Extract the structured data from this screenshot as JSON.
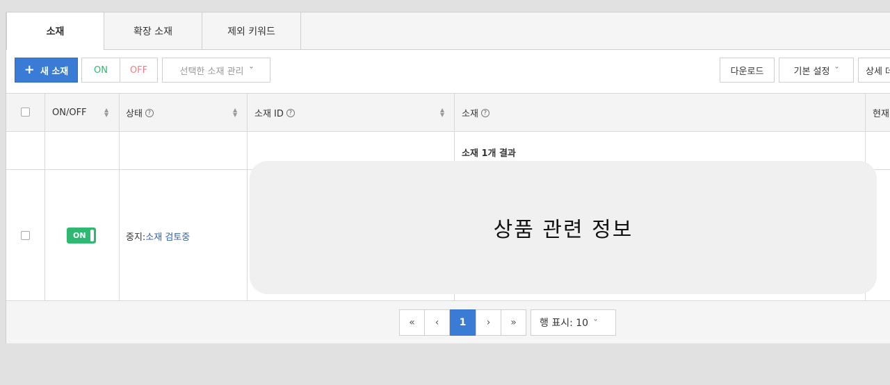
{
  "tabs": [
    {
      "label": "소재"
    },
    {
      "label": "확장 소재"
    },
    {
      "label": "제외 키워드"
    }
  ],
  "toolbar": {
    "new_label": "새 소재",
    "on_label": "ON",
    "off_label": "OFF",
    "manage_label": "선택한 소재 관리",
    "download_label": "다운로드",
    "default_settings_label": "기본 설정",
    "detail_label": "상세 데"
  },
  "table": {
    "headers": {
      "onoff": "ON/OFF",
      "status": "상태",
      "id": "소재 ID",
      "creative": "소재",
      "current": "현재"
    },
    "summary": "소재 1개 결과",
    "row": {
      "toggle": "ON",
      "status_prefix": "중지:",
      "status_link": "소재 검토중"
    }
  },
  "overlay": {
    "text": "상품 관련 정보"
  },
  "pagination": {
    "first": "«",
    "prev": "‹",
    "current_page": "1",
    "next": "›",
    "last": "»",
    "rows_label": "행 표시: 10"
  },
  "colors": {
    "accent": "#3a7bd5",
    "on_green": "#2eb872",
    "off_red": "#f07d85",
    "link": "#2f5fa8"
  },
  "icons": {
    "plus": "plus-icon",
    "help": "help-circle-icon",
    "sort": "sort-icon",
    "chevron": "chevron-down-icon"
  }
}
